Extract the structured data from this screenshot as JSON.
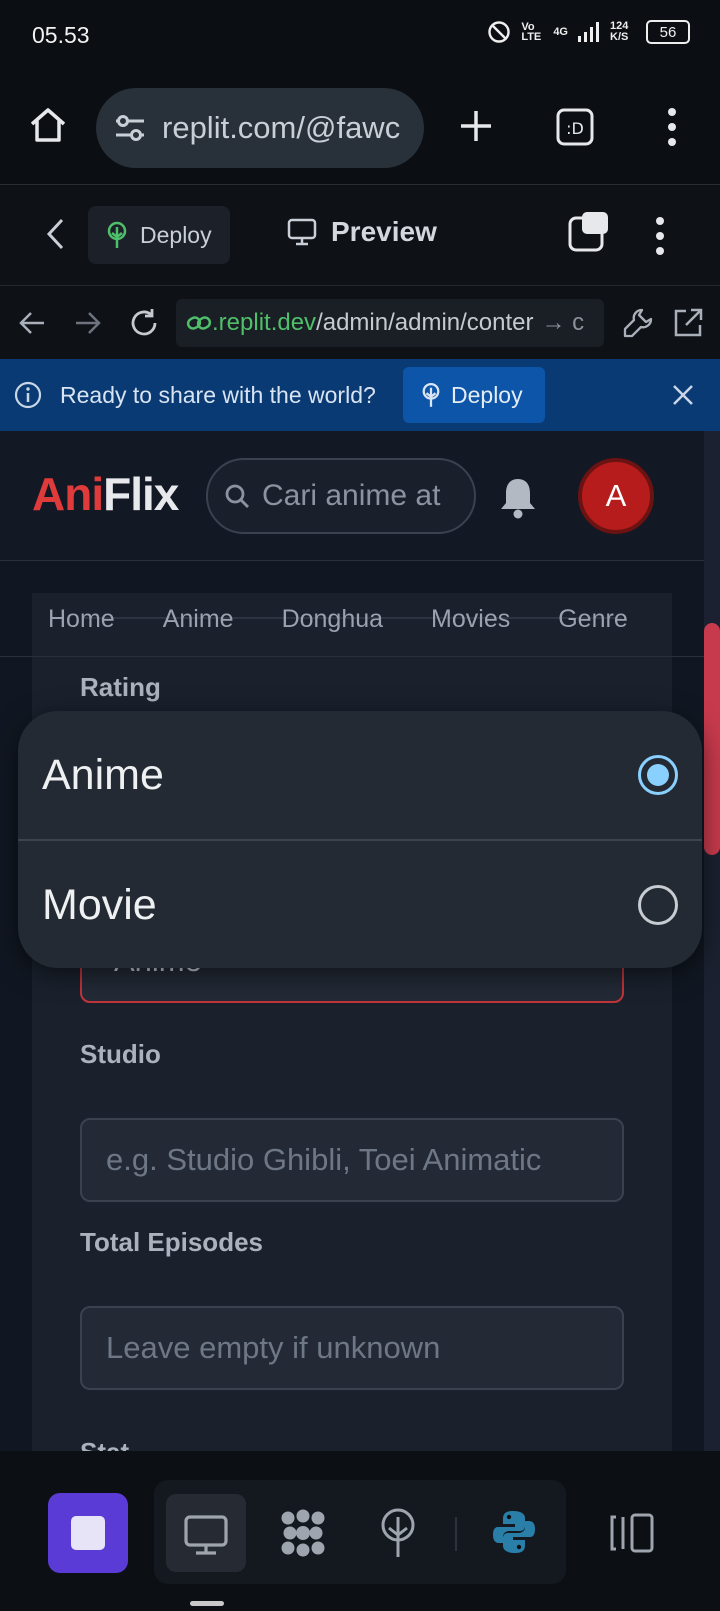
{
  "status_bar": {
    "time": "05.53",
    "net_type": "Vo LTE",
    "signal": "4G",
    "speed": "124 K/S",
    "battery": "56"
  },
  "browser": {
    "url": "replit.com/@fawc"
  },
  "replit_toolbar": {
    "deploy_label": "Deploy",
    "preview_label": "Preview"
  },
  "webview_nav": {
    "address_host": ".replit.dev",
    "address_path": "/admin/admin/conter",
    "address_suffix": "→ c"
  },
  "deploy_banner": {
    "message": "Ready to share with the world?",
    "button_label": "Deploy"
  },
  "site": {
    "logo_part1": "Ani",
    "logo_part2": "Flix",
    "search_placeholder": "Cari anime at",
    "avatar_letter": "A",
    "nav": [
      "Home",
      "Anime",
      "Donghua",
      "Movies",
      "Genre"
    ]
  },
  "form": {
    "rating_label": "Rating",
    "type_value": "Anime",
    "studio_label": "Studio",
    "studio_placeholder": "e.g. Studio Ghibli, Toei Animatic",
    "episodes_label": "Total Episodes",
    "episodes_placeholder": "Leave empty if unknown",
    "status_label_partial": "Stat"
  },
  "dialog": {
    "options": [
      {
        "label": "Anime",
        "selected": true
      },
      {
        "label": "Movie",
        "selected": false
      }
    ]
  },
  "colors": {
    "accent_red": "#e03b3b",
    "banner_blue": "#0a3a73",
    "radio_selected": "#8ad0ff",
    "stop_purple": "#5b3bd6"
  }
}
